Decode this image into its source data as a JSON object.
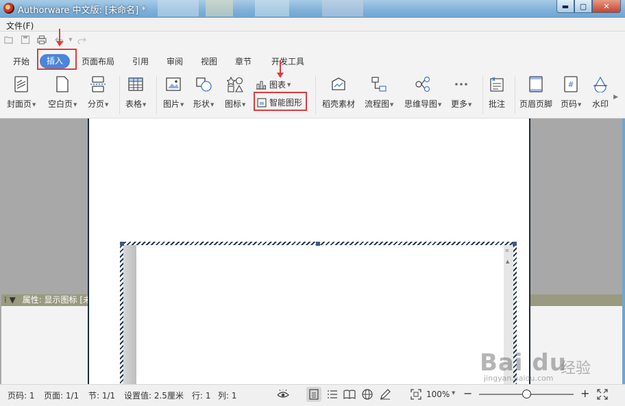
{
  "window": {
    "title": "Authorware 中文版: [未命名] *",
    "minimize_label": "▬",
    "maximize_label": "▢",
    "close_label": "✕"
  },
  "menu": {
    "file": "文件(F)"
  },
  "ribbon_tabs": [
    "开始",
    "插入",
    "页面布局",
    "引用",
    "审阅",
    "视图",
    "章节",
    "开发工具"
  ],
  "active_tab": "插入",
  "ribbon": {
    "cover_page": "封面页",
    "blank_page": "空白页",
    "page_break": "分页",
    "table": "表格",
    "picture": "图片",
    "shape": "形状",
    "icon": "图标",
    "chart": "图表",
    "smart_art": "智能图形",
    "docer_material": "稻壳素材",
    "flowchart": "流程图",
    "mind_map": "思维导图",
    "more": "更多",
    "comment": "批注",
    "header_footer": "页眉页脚",
    "page_number": "页码",
    "watermark": "水印"
  },
  "properties_panel": {
    "title": "属性: 显示图标 [未"
  },
  "status": {
    "page_num": "页码: 1",
    "page_count": "页面: 1/1",
    "section": "节: 1/1",
    "setting": "设置值: 2.5厘米",
    "row": "行: 1",
    "col": "列: 1",
    "zoom": "100%"
  },
  "watermark": {
    "logo": "Bai du",
    "cn": "经验",
    "url": "jingyan.baidu.com"
  },
  "colors": {
    "accent": "#4a86d9",
    "annotation_red": "#e23a3a"
  }
}
